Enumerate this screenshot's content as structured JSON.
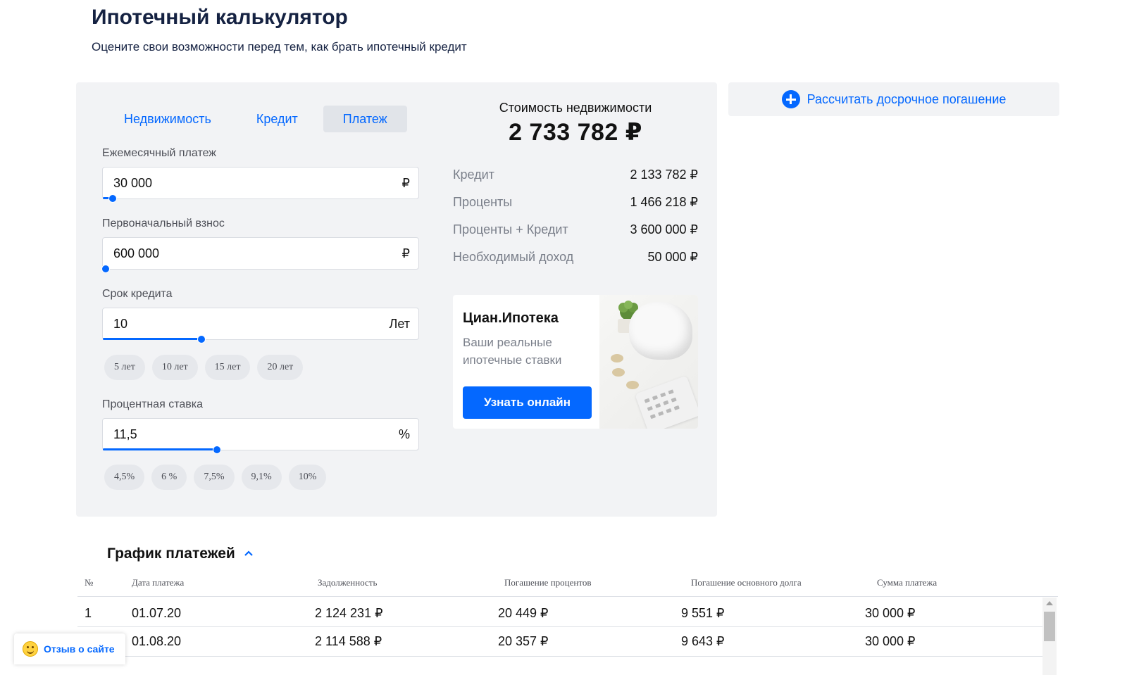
{
  "header": {
    "title": "Ипотечный калькулятор",
    "subtitle": "Оцените свои возможности перед тем, как брать ипотечный кредит"
  },
  "tabs": [
    {
      "label": "Недвижимость",
      "active": false
    },
    {
      "label": "Кредит",
      "active": false
    },
    {
      "label": "Платеж",
      "active": true
    }
  ],
  "fields": {
    "monthly_payment": {
      "label": "Ежемесячный платеж",
      "value": "30 000",
      "unit": "₽",
      "slider_fraction": 0.03
    },
    "down_payment": {
      "label": "Первоначальный взнос",
      "value": "600 000",
      "unit": "₽",
      "slider_fraction": 0.0
    },
    "term": {
      "label": "Срок кредита",
      "value": "10",
      "unit": "Лет",
      "slider_fraction": 0.31
    },
    "rate": {
      "label": "Процентная ставка",
      "value": "11,5",
      "unit": "%",
      "slider_fraction": 0.36
    }
  },
  "term_chips": [
    "5 лет",
    "10 лет",
    "15 лет",
    "20 лет"
  ],
  "rate_chips": [
    "4,5%",
    "6 %",
    "7,5%",
    "9,1%",
    "10%"
  ],
  "summary": {
    "heading": "Стоимость недвижимости",
    "total": "2 733 782 ₽",
    "rows": [
      {
        "label": "Кредит",
        "value": "2 133 782 ₽"
      },
      {
        "label": "Проценты",
        "value": "1 466 218 ₽"
      },
      {
        "label": "Проценты + Кредит",
        "value": "3 600 000 ₽"
      },
      {
        "label": "Необходимый доход",
        "value": "50 000 ₽"
      }
    ]
  },
  "promo": {
    "title": "Циан.Ипотека",
    "text": "Ваши реальные ипотечные ставки",
    "button": "Узнать онлайн"
  },
  "early_repayment": {
    "label": "Рассчитать досрочное погашение",
    "icon": "plus-circle-icon"
  },
  "schedule": {
    "title": "График платежей",
    "columns": [
      "№",
      "Дата платежа",
      "Задолженность",
      "Погашение процентов",
      "Погашение основного долга",
      "Сумма платежа"
    ],
    "rows": [
      [
        "1",
        "01.07.20",
        "2 124 231 ₽",
        "20 449 ₽",
        "9 551 ₽",
        "30 000 ₽"
      ],
      [
        "",
        "01.08.20",
        "2 114 588 ₽",
        "20 357 ₽",
        "9 643 ₽",
        "30 000 ₽"
      ]
    ]
  },
  "feedback": {
    "label": "Отзыв о сайте",
    "icon": "smile-icon"
  },
  "colors": {
    "accent": "#0468ff",
    "panel": "#f2f3f5",
    "title": "#152242"
  }
}
